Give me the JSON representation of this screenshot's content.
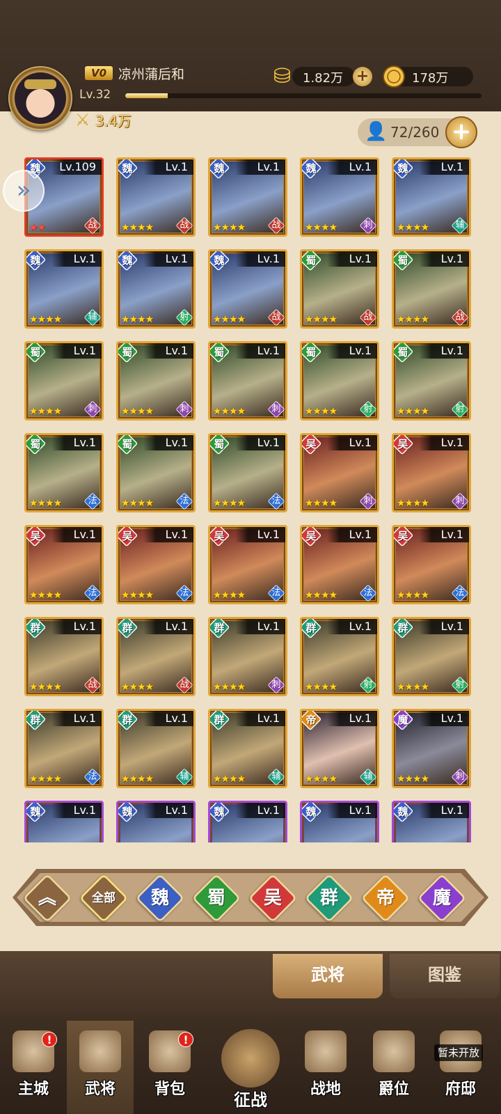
{
  "player": {
    "vip": "V0",
    "name": "凉州蒲后和",
    "level": "Lv.32",
    "exp_fraction": 0.12,
    "power": "3.4万"
  },
  "resources": {
    "gold": "1.82万",
    "coins": "178万"
  },
  "capacity": "72/260",
  "heroes": [
    {
      "faction": "魏",
      "level": "Lv.109",
      "role": "战",
      "frame": "red",
      "stars": "★★"
    },
    {
      "faction": "魏",
      "level": "Lv.1",
      "role": "战",
      "frame": "gold",
      "stars": "★★★★"
    },
    {
      "faction": "魏",
      "level": "Lv.1",
      "role": "战",
      "frame": "gold",
      "stars": "★★★★"
    },
    {
      "faction": "魏",
      "level": "Lv.1",
      "role": "刺",
      "frame": "gold",
      "stars": "★★★★"
    },
    {
      "faction": "魏",
      "level": "Lv.1",
      "role": "辅",
      "frame": "gold",
      "stars": "★★★★"
    },
    {
      "faction": "魏",
      "level": "Lv.1",
      "role": "辅",
      "frame": "gold",
      "stars": "★★★★"
    },
    {
      "faction": "魏",
      "level": "Lv.1",
      "role": "射",
      "frame": "gold",
      "stars": "★★★★"
    },
    {
      "faction": "魏",
      "level": "Lv.1",
      "role": "战",
      "frame": "gold",
      "stars": "★★★★"
    },
    {
      "faction": "蜀",
      "level": "Lv.1",
      "role": "战",
      "frame": "gold",
      "stars": "★★★★"
    },
    {
      "faction": "蜀",
      "level": "Lv.1",
      "role": "战",
      "frame": "gold",
      "stars": "★★★★"
    },
    {
      "faction": "蜀",
      "level": "Lv.1",
      "role": "刺",
      "frame": "gold",
      "stars": "★★★★"
    },
    {
      "faction": "蜀",
      "level": "Lv.1",
      "role": "刺",
      "frame": "gold",
      "stars": "★★★★"
    },
    {
      "faction": "蜀",
      "level": "Lv.1",
      "role": "刺",
      "frame": "gold",
      "stars": "★★★★"
    },
    {
      "faction": "蜀",
      "level": "Lv.1",
      "role": "射",
      "frame": "gold",
      "stars": "★★★★"
    },
    {
      "faction": "蜀",
      "level": "Lv.1",
      "role": "射",
      "frame": "gold",
      "stars": "★★★★"
    },
    {
      "faction": "蜀",
      "level": "Lv.1",
      "role": "法",
      "frame": "gold",
      "stars": "★★★★"
    },
    {
      "faction": "蜀",
      "level": "Lv.1",
      "role": "法",
      "frame": "gold",
      "stars": "★★★★"
    },
    {
      "faction": "蜀",
      "level": "Lv.1",
      "role": "法",
      "frame": "gold",
      "stars": "★★★★"
    },
    {
      "faction": "吴",
      "level": "Lv.1",
      "role": "刺",
      "frame": "gold",
      "stars": "★★★★"
    },
    {
      "faction": "吴",
      "level": "Lv.1",
      "role": "刺",
      "frame": "gold",
      "stars": "★★★★"
    },
    {
      "faction": "吴",
      "level": "Lv.1",
      "role": "法",
      "frame": "gold",
      "stars": "★★★★"
    },
    {
      "faction": "吴",
      "level": "Lv.1",
      "role": "法",
      "frame": "gold",
      "stars": "★★★★"
    },
    {
      "faction": "吴",
      "level": "Lv.1",
      "role": "法",
      "frame": "gold",
      "stars": "★★★★"
    },
    {
      "faction": "吴",
      "level": "Lv.1",
      "role": "法",
      "frame": "gold",
      "stars": "★★★★"
    },
    {
      "faction": "吴",
      "level": "Lv.1",
      "role": "法",
      "frame": "gold",
      "stars": "★★★★"
    },
    {
      "faction": "群",
      "level": "Lv.1",
      "role": "战",
      "frame": "gold",
      "stars": "★★★★"
    },
    {
      "faction": "群",
      "level": "Lv.1",
      "role": "战",
      "frame": "gold",
      "stars": "★★★★"
    },
    {
      "faction": "群",
      "level": "Lv.1",
      "role": "刺",
      "frame": "gold",
      "stars": "★★★★"
    },
    {
      "faction": "群",
      "level": "Lv.1",
      "role": "射",
      "frame": "gold",
      "stars": "★★★★"
    },
    {
      "faction": "群",
      "level": "Lv.1",
      "role": "射",
      "frame": "gold",
      "stars": "★★★★"
    },
    {
      "faction": "群",
      "level": "Lv.1",
      "role": "法",
      "frame": "gold",
      "stars": "★★★★"
    },
    {
      "faction": "群",
      "level": "Lv.1",
      "role": "辅",
      "frame": "gold",
      "stars": "★★★★"
    },
    {
      "faction": "群",
      "level": "Lv.1",
      "role": "辅",
      "frame": "gold",
      "stars": "★★★★"
    },
    {
      "faction": "帝",
      "level": "Lv.1",
      "role": "辅",
      "frame": "gold",
      "stars": "★★★★"
    },
    {
      "faction": "魔",
      "level": "Lv.1",
      "role": "刺",
      "frame": "gold",
      "stars": "★★★★"
    },
    {
      "faction": "魏",
      "level": "Lv.1",
      "role": "",
      "frame": "purple",
      "stars": ""
    },
    {
      "faction": "魏",
      "level": "Lv.1",
      "role": "",
      "frame": "purple",
      "stars": ""
    },
    {
      "faction": "魏",
      "level": "Lv.1",
      "role": "",
      "frame": "purple",
      "stars": ""
    },
    {
      "faction": "魏",
      "level": "Lv.1",
      "role": "",
      "frame": "purple",
      "stars": ""
    },
    {
      "faction": "魏",
      "level": "Lv.1",
      "role": "",
      "frame": "purple",
      "stars": ""
    }
  ],
  "filters": [
    {
      "label": "︽",
      "color": "#8a6540"
    },
    {
      "label": "全部",
      "color": "#8a6540"
    },
    {
      "label": "魏",
      "color": "#3b5fc4"
    },
    {
      "label": "蜀",
      "color": "#2e9a3a"
    },
    {
      "label": "吴",
      "color": "#d2383a"
    },
    {
      "label": "群",
      "color": "#1f9a7a"
    },
    {
      "label": "帝",
      "color": "#e08a1a"
    },
    {
      "label": "魔",
      "color": "#8a3fcf"
    }
  ],
  "tabs": {
    "heroes": "武将",
    "codex": "图鉴"
  },
  "nav": {
    "main_city": "主城",
    "heroes": "武将",
    "bag": "背包",
    "battle": "征战",
    "battlefield": "战地",
    "rank": "爵位",
    "mansion": "府邸",
    "not_open": "暂未开放"
  },
  "colors": {
    "wei": "#3b5fc4",
    "shu": "#2e9a3a",
    "wu": "#d2383a",
    "qun": "#1f9a7a",
    "di": "#e08a1a",
    "mo": "#8a3fcf"
  }
}
